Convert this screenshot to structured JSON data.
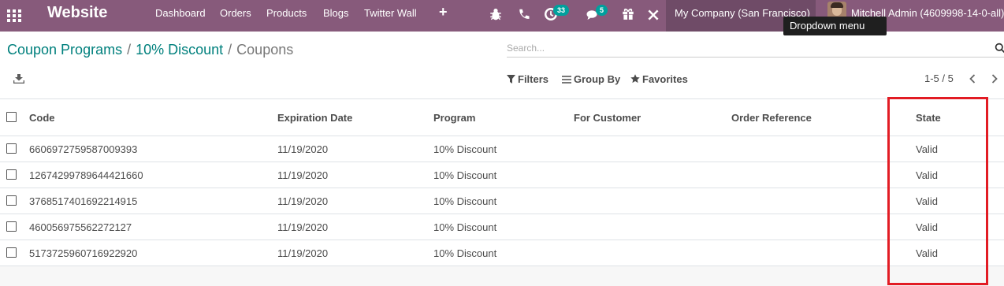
{
  "navbar": {
    "app_name": "Website",
    "menus": [
      "Dashboard",
      "Orders",
      "Products",
      "Blogs",
      "Twitter Wall"
    ],
    "activity_badge": "33",
    "messages_badge": "5",
    "company": "My Company (San Francisco)",
    "user_name": "Mitchell Admin (4609998-14-0-all)",
    "tooltip": "Dropdown menu"
  },
  "breadcrumb": {
    "items": [
      "Coupon Programs",
      "10% Discount"
    ],
    "current": "Coupons",
    "separator": "/"
  },
  "search": {
    "placeholder": "Search..."
  },
  "filters": {
    "filters_label": "Filters",
    "group_by_label": "Group By",
    "favorites_label": "Favorites"
  },
  "pager": {
    "value": "1-5 / 5"
  },
  "table": {
    "columns": [
      "Code",
      "Expiration Date",
      "Program",
      "For Customer",
      "Order Reference",
      "State"
    ],
    "rows": [
      {
        "code": "6606972759587009393",
        "expiration": "11/19/2020",
        "program": "10% Discount",
        "customer": "",
        "order": "",
        "state": "Valid"
      },
      {
        "code": "12674299789644421660",
        "expiration": "11/19/2020",
        "program": "10% Discount",
        "customer": "",
        "order": "",
        "state": "Valid"
      },
      {
        "code": "3768517401692214915",
        "expiration": "11/19/2020",
        "program": "10% Discount",
        "customer": "",
        "order": "",
        "state": "Valid"
      },
      {
        "code": "460056975562272127",
        "expiration": "11/19/2020",
        "program": "10% Discount",
        "customer": "",
        "order": "",
        "state": "Valid"
      },
      {
        "code": "5173725960716922920",
        "expiration": "11/19/2020",
        "program": "10% Discount",
        "customer": "",
        "order": "",
        "state": "Valid"
      }
    ]
  },
  "colors": {
    "navbar": "#875a7b",
    "company_bg": "#6f4b67",
    "link": "#00807d",
    "badge": "#00a09d",
    "highlight": "#e21c24"
  },
  "icons": {
    "apps": "apps-grid-icon",
    "plus": "plus-icon",
    "debug": "bug-icon",
    "phone": "phone-icon",
    "activity": "clock-icon",
    "messages": "chat-icon",
    "gift": "gift-icon",
    "tools": "tools-icon",
    "download": "download-icon",
    "search": "search-icon"
  }
}
